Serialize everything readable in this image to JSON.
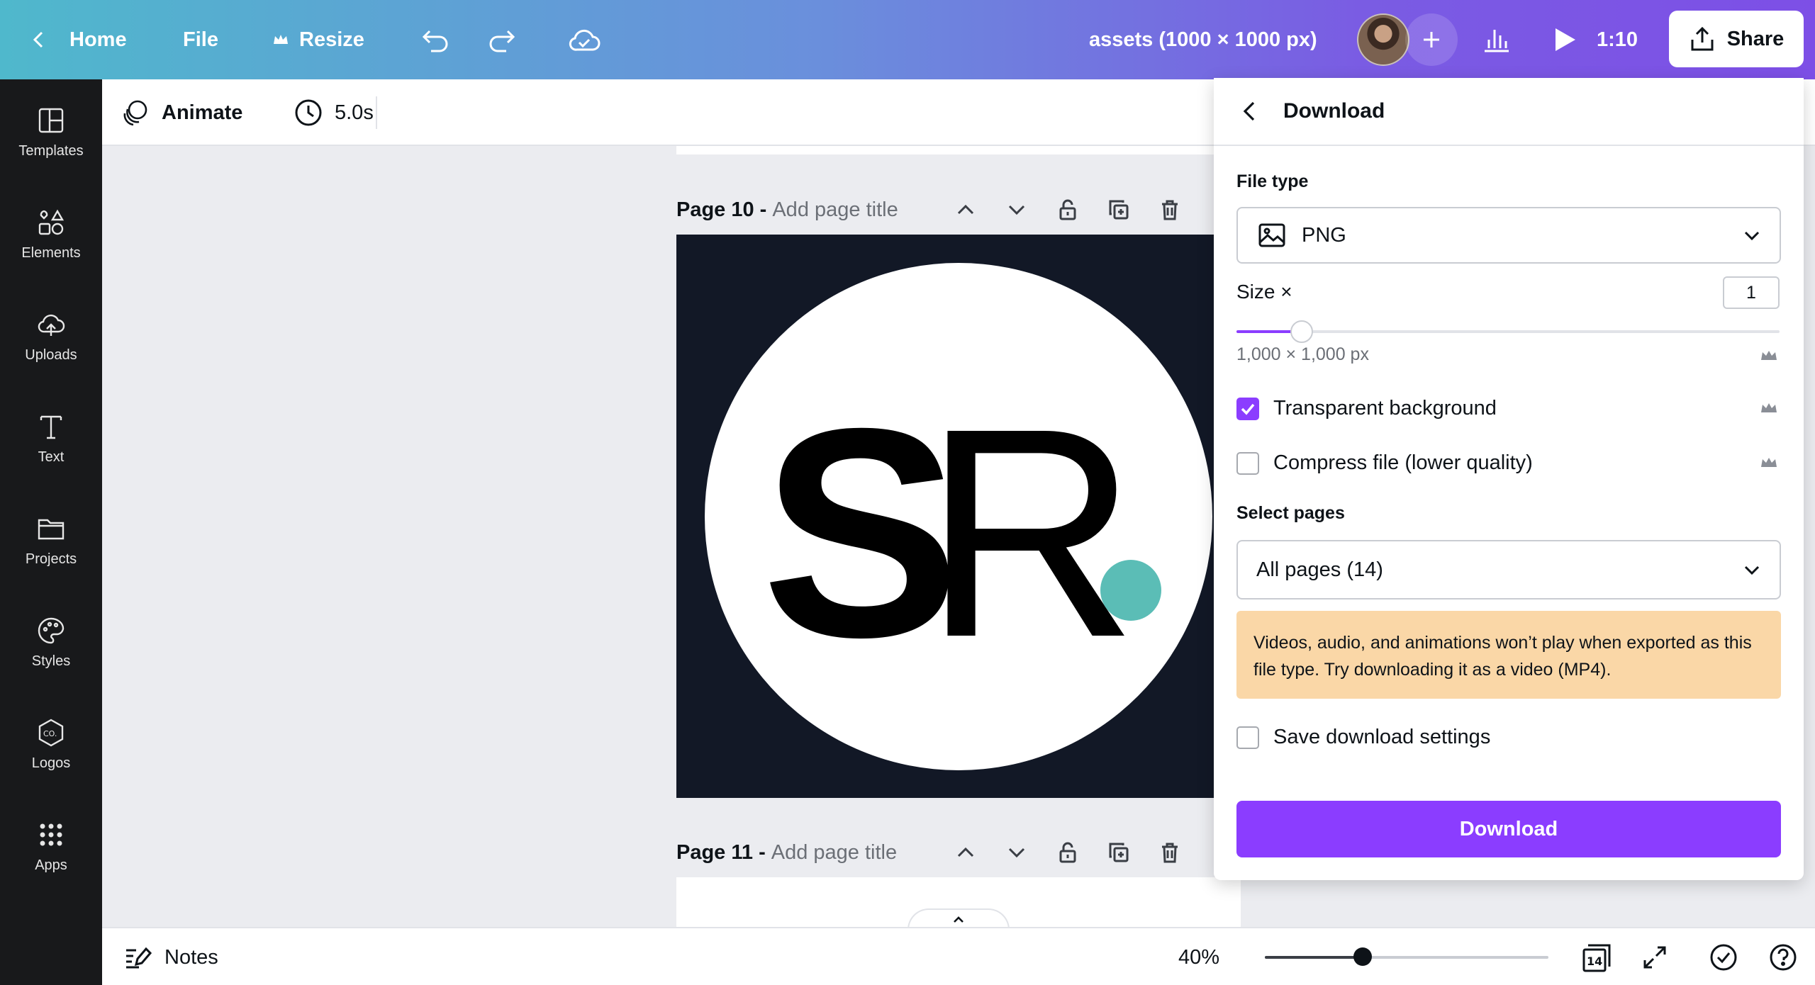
{
  "topbar": {
    "home_label": "Home",
    "file_label": "File",
    "resize_label": "Resize",
    "doc_title": "assets (1000 × 1000 px)",
    "timer_label": "1:10",
    "share_label": "Share",
    "icons": [
      "chevron-left-icon",
      "crown-icon",
      "undo-icon",
      "redo-icon",
      "cloud-check-icon",
      "plus-icon",
      "analytics-icon",
      "play-icon",
      "share-upload-icon"
    ]
  },
  "sidebar": {
    "items": [
      {
        "label": "Templates",
        "icon": "templates-icon"
      },
      {
        "label": "Elements",
        "icon": "elements-icon"
      },
      {
        "label": "Uploads",
        "icon": "upload-cloud-icon"
      },
      {
        "label": "Text",
        "icon": "text-icon"
      },
      {
        "label": "Projects",
        "icon": "folder-icon"
      },
      {
        "label": "Styles",
        "icon": "palette-icon"
      },
      {
        "label": "Logos",
        "icon": "logo-badge-icon"
      },
      {
        "label": "Apps",
        "icon": "apps-grid-icon"
      }
    ]
  },
  "subbar": {
    "animate_label": "Animate",
    "duration_label": "5.0s"
  },
  "canvas": {
    "page10_label": "Page 10 -",
    "page10_title_placeholder": "Add page title",
    "page11_label": "Page 11 -",
    "page11_title_placeholder": "Add page title",
    "logo_text_s": "S",
    "logo_text_r": "R",
    "artboard_bg": "#121826",
    "accent_dot_color": "#5bbdb6"
  },
  "bottombar": {
    "notes_label": "Notes",
    "zoom_label": "40%",
    "zoom_level": 0.4,
    "page_count": "14"
  },
  "download_panel": {
    "title": "Download",
    "file_type_label": "File type",
    "file_type_value": "PNG",
    "size_label": "Size ×",
    "size_value": "1",
    "size_slider_fraction": 0.12,
    "dimensions": "1,000 × 1,000 px",
    "transparent_bg_label": "Transparent background",
    "transparent_bg_checked": true,
    "compress_label": "Compress file (lower quality)",
    "compress_checked": false,
    "select_pages_label": "Select pages",
    "pages_value": "All pages (14)",
    "notice_text": "Videos, audio, and animations won’t play when exported as this file type. Try downloading it as a video (MP4).",
    "save_settings_label": "Save download settings",
    "save_settings_checked": false,
    "download_button_label": "Download",
    "accent_color": "#8b3dff",
    "notice_color": "#fad7a7"
  }
}
